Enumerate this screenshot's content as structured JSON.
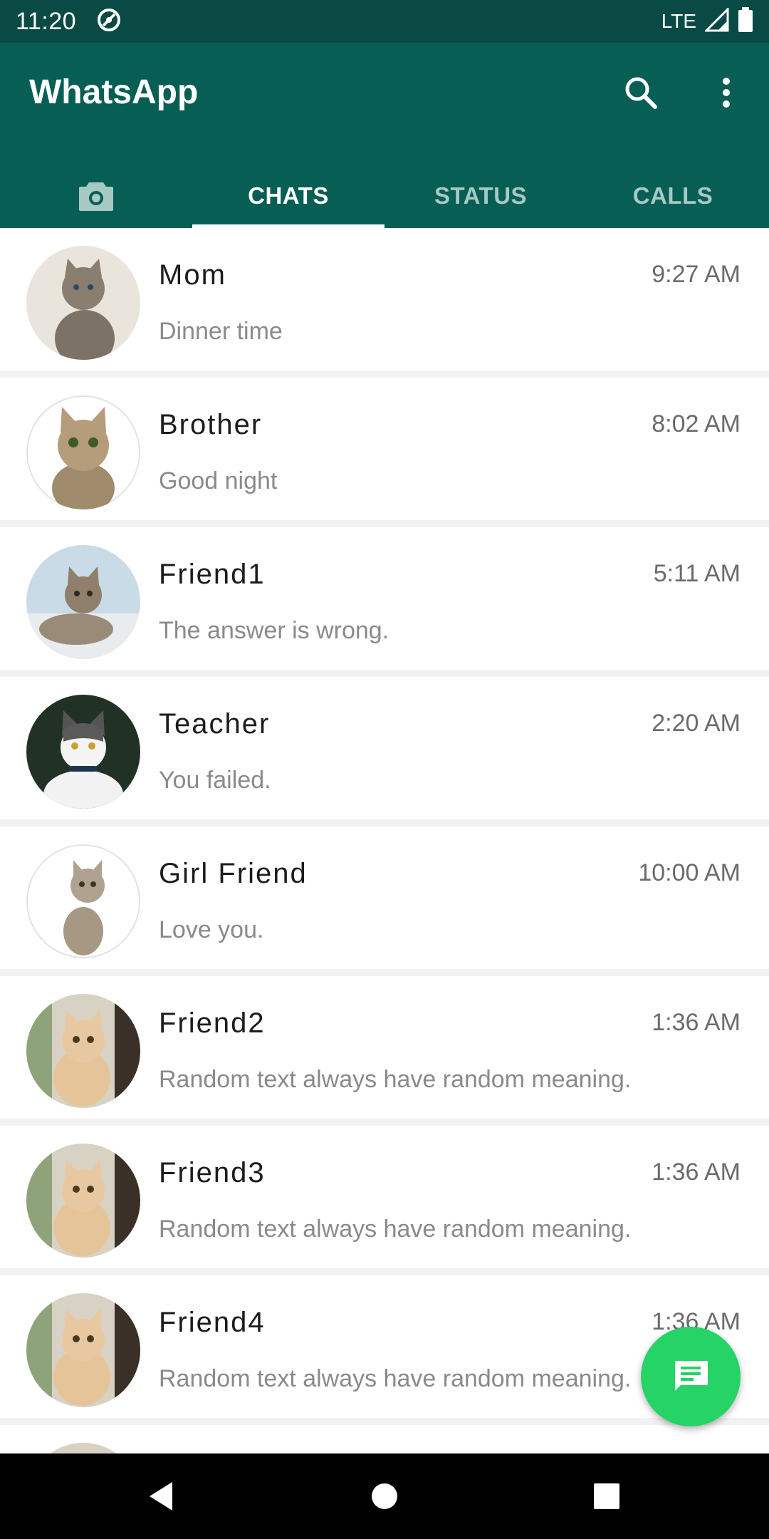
{
  "status_bar": {
    "time": "11:20",
    "network": "LTE"
  },
  "app_bar": {
    "title": "WhatsApp"
  },
  "tabs": [
    {
      "label": "",
      "icon": "camera-icon"
    },
    {
      "label": "CHATS",
      "active": true
    },
    {
      "label": "STATUS"
    },
    {
      "label": "CALLS"
    }
  ],
  "chats": [
    {
      "name": "Mom",
      "time": "9:27 AM",
      "message": "Dinner time"
    },
    {
      "name": "Brother",
      "time": "8:02 AM",
      "message": "Good night"
    },
    {
      "name": "Friend1",
      "time": "5:11 AM",
      "message": "The answer is wrong."
    },
    {
      "name": "Teacher",
      "time": "2:20 AM",
      "message": "You failed."
    },
    {
      "name": "Girl Friend",
      "time": "10:00 AM",
      "message": "Love you."
    },
    {
      "name": "Friend2",
      "time": "1:36 AM",
      "message": "Random text always have random meaning."
    },
    {
      "name": "Friend3",
      "time": "1:36 AM",
      "message": "Random text always have random meaning."
    },
    {
      "name": "Friend4",
      "time": "1:36 AM",
      "message": "Random text always have random meaning."
    }
  ],
  "colors": {
    "primary": "#075e54",
    "status_bar": "#0a4a44",
    "fab": "#25d366",
    "tab_inactive": "#a7c9c4"
  },
  "icons": {
    "search": "search-icon",
    "menu": "more-vert-icon",
    "fab": "new-chat-icon",
    "nav_back": "nav-back-icon",
    "nav_home": "nav-home-icon",
    "nav_recents": "nav-recents-icon"
  }
}
